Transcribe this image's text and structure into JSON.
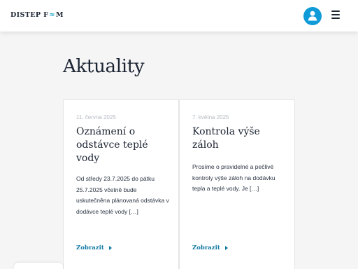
{
  "header": {
    "logo_left": "DISTEP F",
    "logo_right": "M",
    "user_icon": "user-icon",
    "menu_icon": "hamburger-menu-icon"
  },
  "page": {
    "title": "Aktuality"
  },
  "cards": [
    {
      "date": "11. června 2025",
      "title": "Oznámení o odstávce teplé vody",
      "excerpt": "Od středy 23.7.2025 do pátku 25.7.2025 včetně bude uskutečněna plánovaná odstávka v dodávce teplé vody […]",
      "link": "Zobrazit"
    },
    {
      "date": "7. května 2025",
      "title": "Kontrola výše záloh",
      "excerpt": "Prosíme o pravidelné a pečlivé kontroly výše záloh na dodávku tepla a teplé vody. Je […]",
      "link": "Zobrazit"
    }
  ],
  "colors": {
    "accent": "#0f9bd7",
    "link": "#127aa6",
    "text": "#1b2433",
    "background": "#f5f5f5"
  }
}
